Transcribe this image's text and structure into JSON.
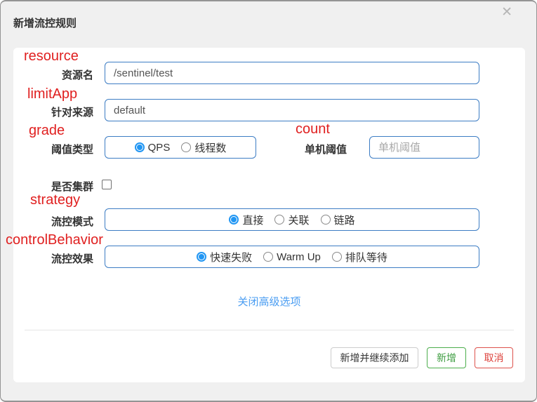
{
  "dialog": {
    "title": "新增流控规则",
    "close_glyph": "✕"
  },
  "fields": {
    "resource": {
      "annotation": "resource",
      "label": "资源名",
      "value": "/sentinel/test"
    },
    "limitApp": {
      "annotation": "limitApp",
      "label": "针对来源",
      "value": "default"
    },
    "grade": {
      "annotation": "grade",
      "label": "阈值类型",
      "options": [
        {
          "label": "QPS",
          "selected": true
        },
        {
          "label": "线程数",
          "selected": false
        }
      ]
    },
    "count": {
      "annotation": "count",
      "label": "单机阈值",
      "value": "",
      "placeholder": "单机阈值"
    },
    "cluster": {
      "label": "是否集群",
      "checked": false
    },
    "strategy": {
      "annotation": "strategy",
      "label": "流控模式",
      "options": [
        {
          "label": "直接",
          "selected": true
        },
        {
          "label": "关联",
          "selected": false
        },
        {
          "label": "链路",
          "selected": false
        }
      ]
    },
    "controlBehavior": {
      "annotation": "controlBehavior",
      "label": "流控效果",
      "options": [
        {
          "label": "快速失败",
          "selected": true
        },
        {
          "label": "Warm Up",
          "selected": false
        },
        {
          "label": "排队等待",
          "selected": false
        }
      ]
    }
  },
  "advanced_link": "关闭高级选项",
  "footer": {
    "add_continue_label": "新增并继续添加",
    "add_label": "新增",
    "cancel_label": "取消"
  },
  "colors": {
    "annotation_red": "#e02020",
    "input_border_blue": "#3d7dc4",
    "radio_blue": "#2196f3",
    "link_blue": "#4a9df2",
    "button_green": "#4cae4c",
    "button_red": "#dd524c",
    "dialog_bg": "#f0f0f0",
    "panel_bg": "#ffffff"
  }
}
